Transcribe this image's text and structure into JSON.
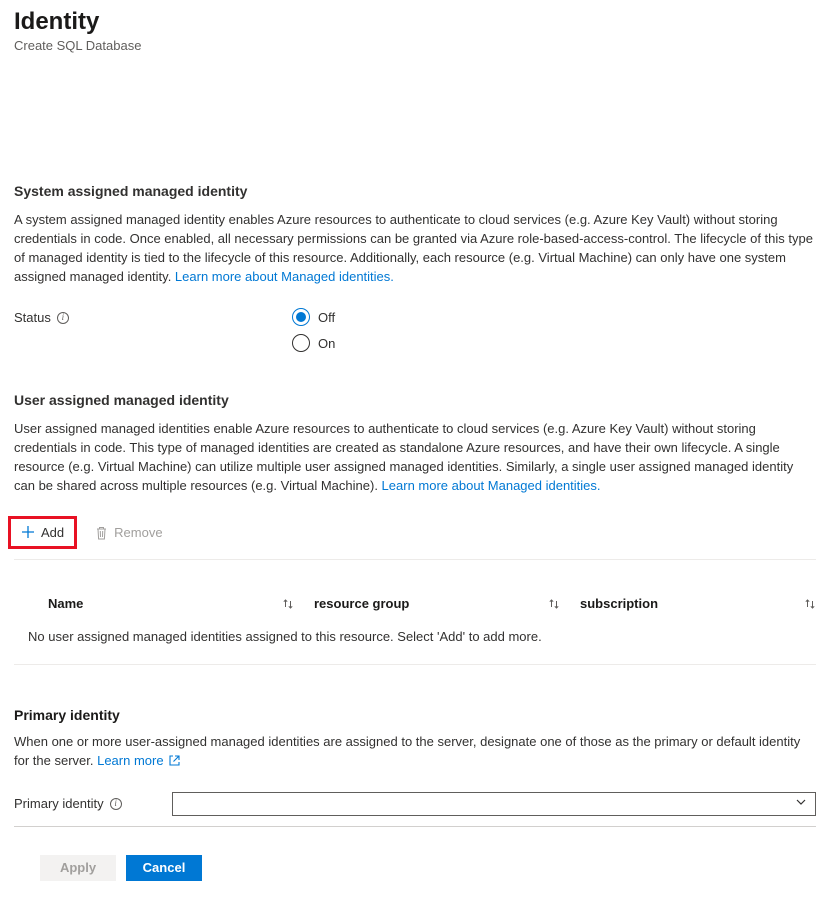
{
  "header": {
    "title": "Identity",
    "subtitle": "Create SQL Database"
  },
  "system_assigned": {
    "heading": "System assigned managed identity",
    "body": "A system assigned managed identity enables Azure resources to authenticate to cloud services (e.g. Azure Key Vault) without storing credentials in code. Once enabled, all necessary permissions can be granted via Azure role-based-access-control. The lifecycle of this type of managed identity is tied to the lifecycle of this resource. Additionally, each resource (e.g. Virtual Machine) can only have one system assigned managed identity. ",
    "learn_more": "Learn more about Managed identities.",
    "status_label": "Status",
    "options": {
      "off": "Off",
      "on": "On"
    },
    "selected": "off"
  },
  "user_assigned": {
    "heading": "User assigned managed identity",
    "body": "User assigned managed identities enable Azure resources to authenticate to cloud services (e.g. Azure Key Vault) without storing credentials in code. This type of managed identities are created as standalone Azure resources, and have their own lifecycle. A single resource (e.g. Virtual Machine) can utilize multiple user assigned managed identities. Similarly, a single user assigned managed identity can be shared across multiple resources (e.g. Virtual Machine). ",
    "learn_more": "Learn more about Managed identities.",
    "toolbar": {
      "add": "Add",
      "remove": "Remove"
    },
    "table": {
      "columns": {
        "name": "Name",
        "resource_group": "resource group",
        "subscription": "subscription"
      },
      "empty_message": "No user assigned managed identities assigned to this resource. Select 'Add' to add more."
    }
  },
  "primary_identity": {
    "heading": "Primary identity",
    "body": "When one or more user-assigned managed identities are assigned to the server, designate one of those as the primary or default identity for the server. ",
    "learn_more": "Learn more",
    "field_label": "Primary identity",
    "value": ""
  },
  "footer": {
    "apply": "Apply",
    "cancel": "Cancel"
  }
}
